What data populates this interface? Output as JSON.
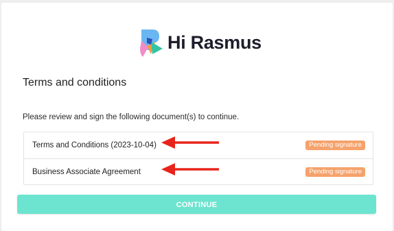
{
  "brand": {
    "name": "Hi Rasmus"
  },
  "page": {
    "title": "Terms and conditions",
    "intro": "Please review and sign the following document(s) to continue."
  },
  "documents": [
    {
      "name": "Terms and Conditions (2023-10-04)",
      "status": "Pending signature"
    },
    {
      "name": "Business Associate Agreement",
      "status": "Pending signature"
    }
  ],
  "actions": {
    "continue_label": "CONTINUE"
  },
  "colors": {
    "accent": "#6de4cf",
    "badge": "#f5a26b",
    "annotation_arrow": "#e8231b"
  }
}
